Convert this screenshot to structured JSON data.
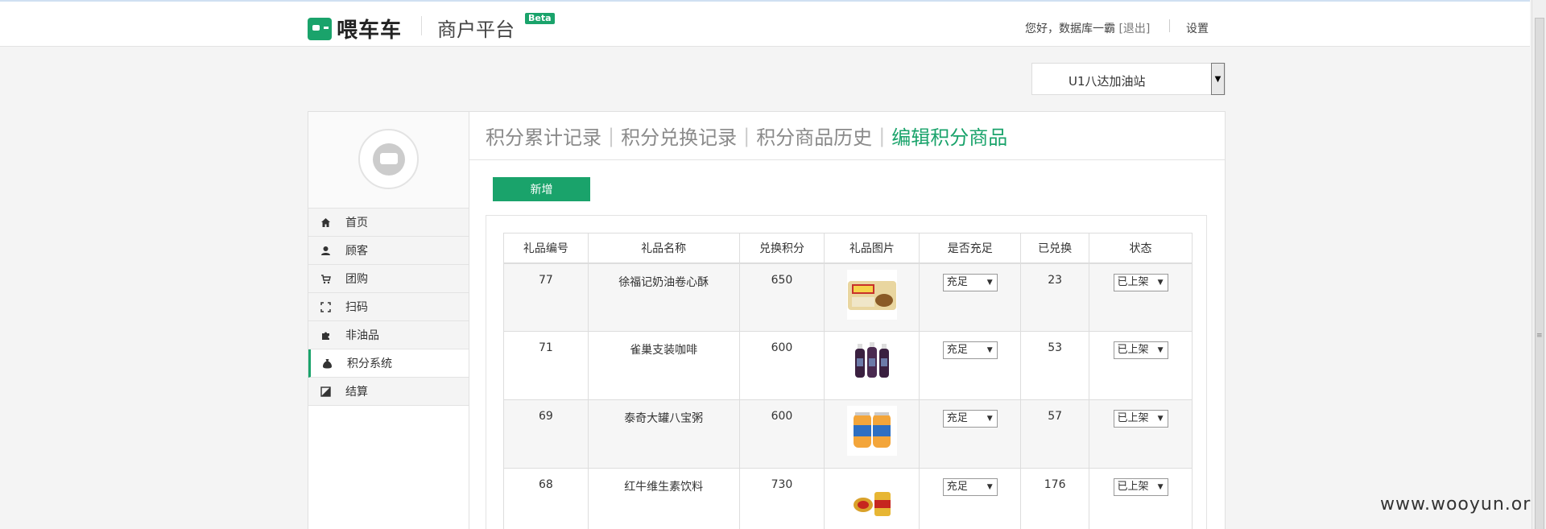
{
  "header": {
    "logo_text": "喂车车",
    "platform": "商户平台",
    "beta": "Beta",
    "greeting": "您好，数据库一霸",
    "logout": "[退出]",
    "settings": "设置"
  },
  "station_select": {
    "value": "U1八达加油站"
  },
  "sidebar": {
    "items": [
      {
        "label": "首页",
        "icon": "home-icon"
      },
      {
        "label": "顾客",
        "icon": "user-icon"
      },
      {
        "label": "团购",
        "icon": "cart-icon"
      },
      {
        "label": "扫码",
        "icon": "scan-icon"
      },
      {
        "label": "非油品",
        "icon": "puzzle-icon"
      },
      {
        "label": "积分系统",
        "icon": "money-bag-icon"
      },
      {
        "label": "结算",
        "icon": "settle-icon"
      }
    ],
    "active_index": 5
  },
  "tabs": [
    {
      "label": "积分累计记录"
    },
    {
      "label": "积分兑换记录"
    },
    {
      "label": "积分商品历史"
    },
    {
      "label": "编辑积分商品"
    }
  ],
  "add_button": "新增",
  "table": {
    "headers": [
      "礼品编号",
      "礼品名称",
      "兑换积分",
      "礼品图片",
      "是否充足",
      "已兑换",
      "状态"
    ],
    "rows": [
      {
        "id": "77",
        "name": "徐福记奶油卷心酥",
        "points": "650",
        "image": "wafer-roll-package",
        "stock": "充足",
        "redeemed": "23",
        "status": "已上架"
      },
      {
        "id": "71",
        "name": "雀巢支装咖啡",
        "points": "600",
        "image": "coffee-bottles",
        "stock": "充足",
        "redeemed": "53",
        "status": "已上架"
      },
      {
        "id": "69",
        "name": "泰奇大罐八宝粥",
        "points": "600",
        "image": "porridge-cans",
        "stock": "充足",
        "redeemed": "57",
        "status": "已上架"
      },
      {
        "id": "68",
        "name": "红牛维生素饮料",
        "points": "730",
        "image": "redbull-cans",
        "stock": "充足",
        "redeemed": "176",
        "status": "已上架"
      }
    ]
  },
  "watermark": "www.wooyun.org",
  "colors": {
    "accent": "#1aa36b",
    "tab_inactive": "#8a8a8a"
  }
}
